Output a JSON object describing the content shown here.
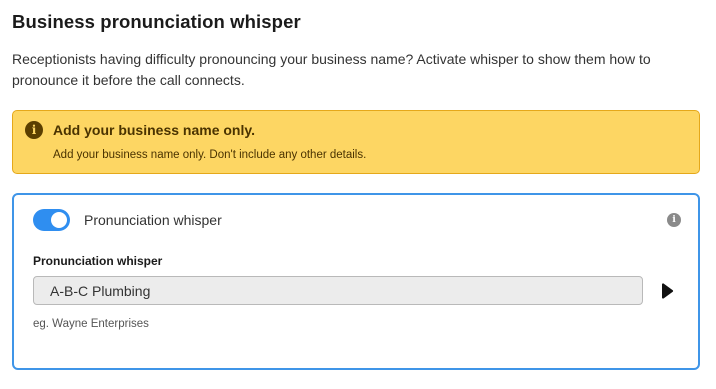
{
  "section": {
    "title": "Business pronunciation whisper",
    "description": "Receptionists having difficulty pronouncing your business name? Activate whisper to show them how to pronounce it before the call connects."
  },
  "alert": {
    "icon": "info-filled-icon",
    "heading": "Add your business name only.",
    "body": "Add your business name only. Don't include any other details.",
    "background_color": "#fdd663",
    "border_color": "#e5a81a"
  },
  "card": {
    "border_color": "#3f95e8",
    "toggle": {
      "label": "Pronunciation whisper",
      "enabled": true,
      "color": "#2f8ef0"
    },
    "info_icon": "info-icon",
    "field": {
      "label": "Pronunciation whisper",
      "value": "A-B-C Plumbing",
      "hint": "eg. Wayne Enterprises"
    },
    "play_icon": "play-icon"
  }
}
